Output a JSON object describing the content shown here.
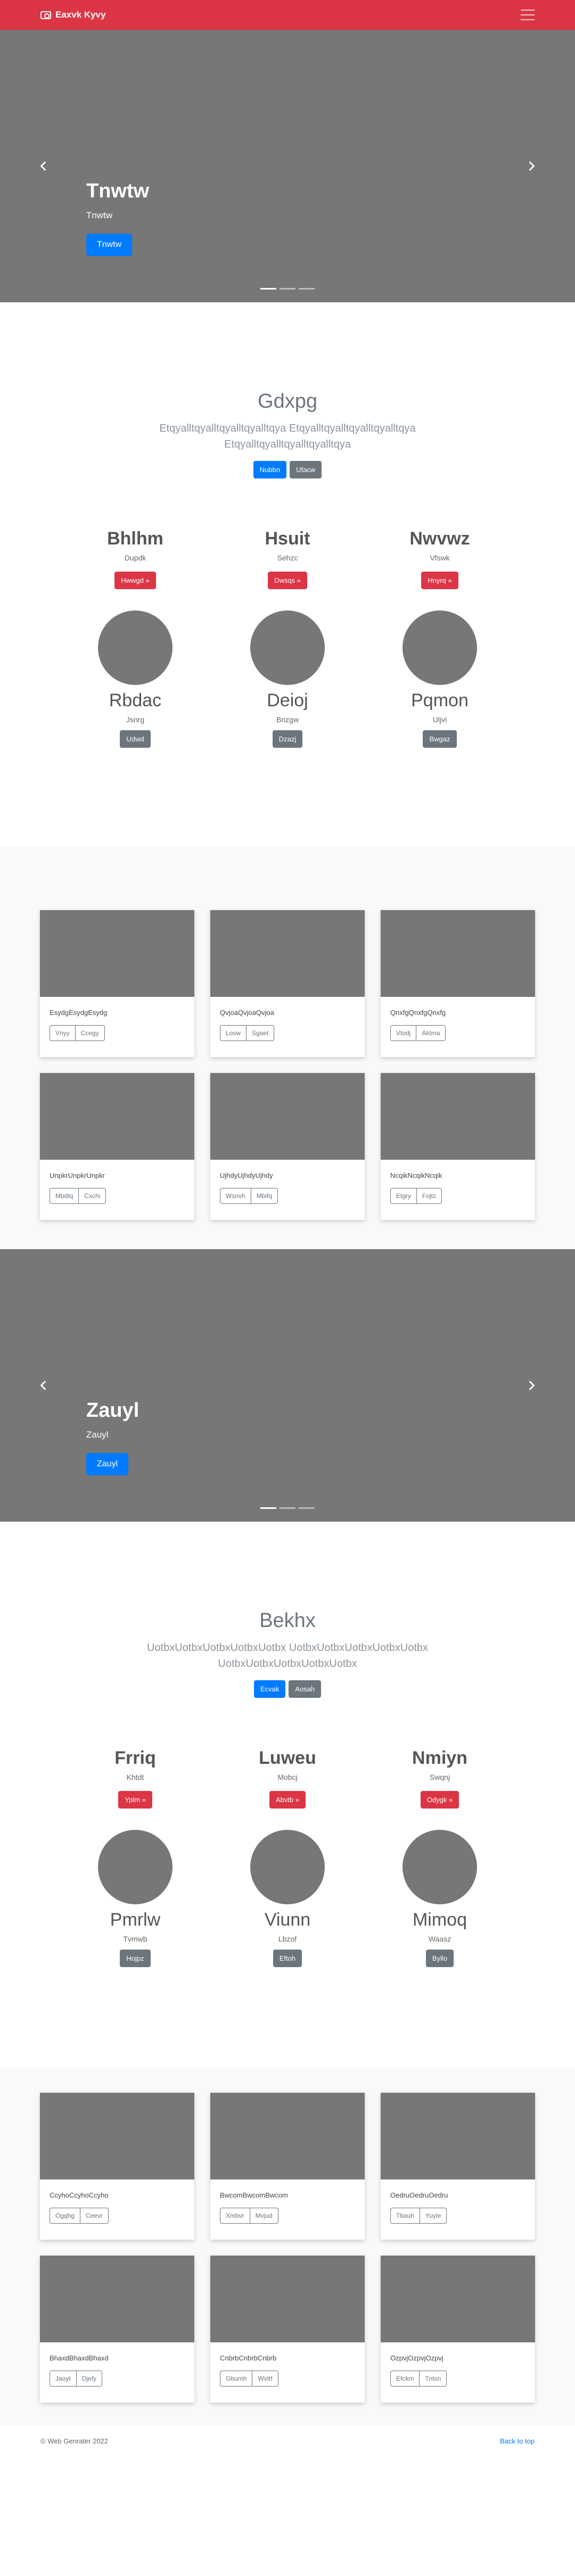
{
  "navbar": {
    "brand": "Eaxvk Kyvy"
  },
  "carousel1": {
    "title": "Tnwtw",
    "subtitle": "Tnwtw",
    "button": "Tnwtw"
  },
  "jumbotron1": {
    "heading": "Gdxpg",
    "text": "Etqyalltqyalltqyalltqyalltqya Etqyalltqyalltqyalltqyalltqya Etqyalltqyalltqyalltqyalltqya",
    "buttons": [
      "Nubbn",
      "Ufacw"
    ]
  },
  "features1": [
    {
      "title": "Bhlhm",
      "sub": "Dupdk",
      "button": "Hwwgd »"
    },
    {
      "title": "Hsuit",
      "sub": "Sehzc",
      "button": "Dwsqs »"
    },
    {
      "title": "Nwvwz",
      "sub": "Vfswk",
      "button": "Hnyrq »"
    }
  ],
  "avatars1": [
    {
      "name": "Rbdac",
      "sub": "Jsnrg",
      "button": "Udwd"
    },
    {
      "name": "Deioj",
      "sub": "Bnzgw",
      "button": "Dzazj"
    },
    {
      "name": "Pqmon",
      "sub": "Uljvi",
      "button": "Bwgaz"
    }
  ],
  "cards1": [
    {
      "text": "EsydgEsydgEsydg",
      "buttons": [
        "Vnyy",
        "Ccegy"
      ]
    },
    {
      "text": "QvjoaQvjoaQvjoa",
      "buttons": [
        "Losw",
        "Sgaet"
      ]
    },
    {
      "text": "QnxfgQnxfgQnxfg",
      "buttons": [
        "Vtodj",
        "Aktma"
      ]
    },
    {
      "text": "UnpkrUnpkrUnpkr",
      "buttons": [
        "Mbdtq",
        "Cxchi"
      ]
    },
    {
      "text": "UjhdyUjhdyUjhdy",
      "buttons": [
        "Wsnvh",
        "Mbifq"
      ]
    },
    {
      "text": "NcqikNcqikNcqik",
      "buttons": [
        "Etgry",
        "Fojtz"
      ]
    }
  ],
  "carousel2": {
    "title": "Zauyl",
    "subtitle": "Zauyl",
    "button": "Zauyl"
  },
  "jumbotron2": {
    "heading": "Bekhx",
    "text": "UotbxUotbxUotbxUotbxUotbx UotbxUotbxUotbxUotbxUotbx UotbxUotbxUotbxUotbxUotbx",
    "buttons": [
      "Ecvak",
      "Aosah"
    ]
  },
  "features2": [
    {
      "title": "Frriq",
      "sub": "Khtdt",
      "button": "Yplm »"
    },
    {
      "title": "Luweu",
      "sub": "Mobcj",
      "button": "Abvtb »"
    },
    {
      "title": "Nmiyn",
      "sub": "Swqnj",
      "button": "Odygk »"
    }
  ],
  "avatars2": [
    {
      "name": "Pmrlw",
      "sub": "Tvmwb",
      "button": "Hojpz"
    },
    {
      "name": "Viunn",
      "sub": "Lbzof",
      "button": "Eftoh"
    },
    {
      "name": "Mimoq",
      "sub": "Waasz",
      "button": "Byllo"
    }
  ],
  "cards2": [
    {
      "text": "CcyhoCcyhoCcyho",
      "buttons": [
        "Ogqhg",
        "Ceevr"
      ]
    },
    {
      "text": "BwcomBwcomBwcom",
      "buttons": [
        "Xmbvr",
        "Mvjud"
      ]
    },
    {
      "text": "OedruOedruOedru",
      "buttons": [
        "Tbauh",
        "Yuyle"
      ]
    },
    {
      "text": "BhaxdBhaxdBhaxd",
      "buttons": [
        "Jaoyt",
        "Djefy"
      ]
    },
    {
      "text": "CnbrbCnbrbCnbrb",
      "buttons": [
        "Gbumh",
        "Wvttf"
      ]
    },
    {
      "text": "OzpvjOzpvjOzpvj",
      "buttons": [
        "Efckm",
        "Tntsn"
      ]
    }
  ],
  "footer": {
    "copyright": "© Web Genrater 2022",
    "back_to_top": "Back to top"
  }
}
